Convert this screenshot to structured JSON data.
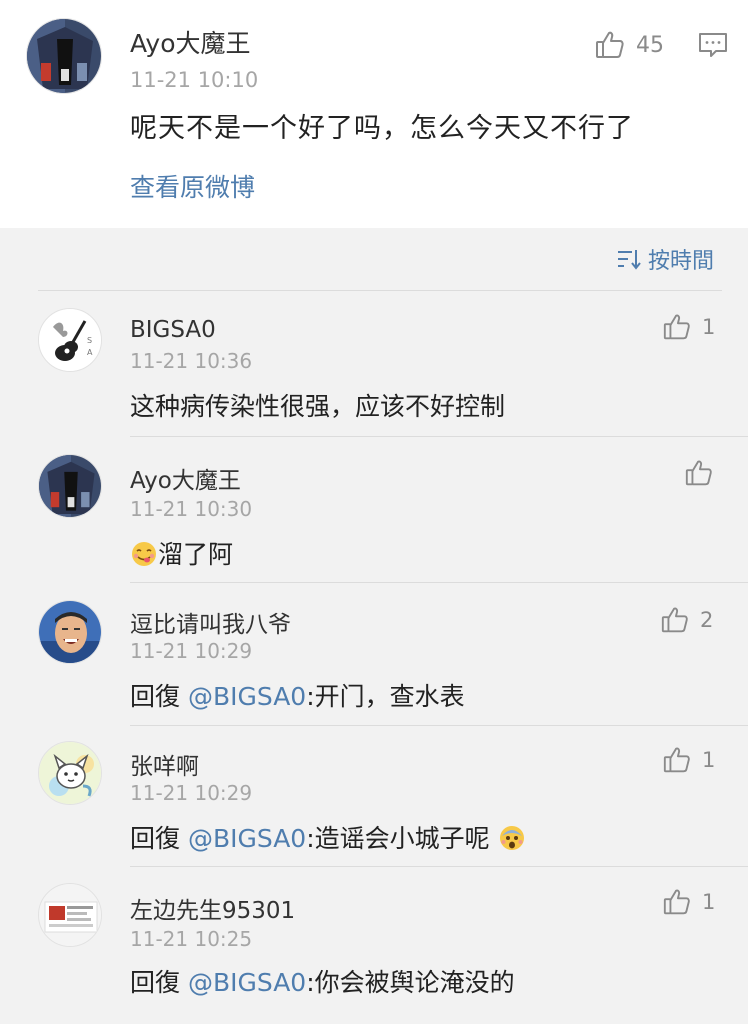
{
  "post": {
    "author": "Ayo大魔王",
    "time": "11-21 10:10",
    "text": "呢天不是一个好了吗，怎么今天又不行了",
    "likes": "45",
    "view_original": "查看原微博"
  },
  "sort": {
    "label": "按時間"
  },
  "comments": [
    {
      "author": "BIGSA0",
      "time": "11-21 10:36",
      "text": "这种病传染性很强，应该不好控制",
      "likes": "1",
      "avatar": "guitar-avatar"
    },
    {
      "author": "Ayo大魔王",
      "time": "11-21 10:30",
      "text": "溜了阿",
      "likes": "",
      "emoji": "yum-face-emoji",
      "avatar": "jacket-avatar"
    },
    {
      "author": "逗比请叫我八爷",
      "time": "11-21 10:29",
      "reply_prefix": "回復",
      "mention": "@BIGSA0",
      "text": ":开门，查水表",
      "likes": "2",
      "avatar": "laughing-man-avatar"
    },
    {
      "author": "张咩啊",
      "time": "11-21 10:29",
      "reply_prefix": "回復",
      "mention": "@BIGSA0",
      "text": ":造谣会小城子呢",
      "likes": "1",
      "emoji": "fearful-face-emoji",
      "avatar": "cartoon-avatar"
    },
    {
      "author": "左边先生95301",
      "time": "11-21 10:25",
      "reply_prefix": "回復",
      "mention": "@BIGSA0",
      "text": ":你会被舆论淹没的",
      "likes": "1",
      "avatar": "screenshot-avatar"
    }
  ],
  "colors": {
    "link": "#4f7dae",
    "time": "#a6a6a6",
    "background": "#f2f2f2"
  }
}
